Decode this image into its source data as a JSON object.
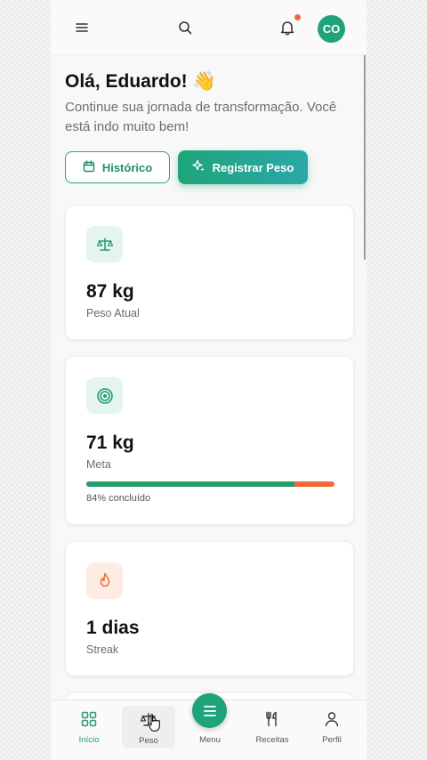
{
  "header": {
    "menu_icon": "menu-icon",
    "search_icon": "search-icon",
    "notifications_icon": "bell-icon",
    "avatar_initials": "CO"
  },
  "greeting": {
    "title": "Olá, Eduardo!",
    "emoji": "👋",
    "subtitle": "Continue sua jornada de transformação. Você está indo muito bem!"
  },
  "actions": {
    "history_label": "Histórico",
    "register_label": "Registrar Peso"
  },
  "cards": [
    {
      "icon": "scale-icon",
      "value": "87 kg",
      "label": "Peso Atual"
    },
    {
      "icon": "target-icon",
      "value": "71 kg",
      "label": "Meta",
      "progress_percent": 84,
      "progress_text": "84% concluído"
    },
    {
      "icon": "flame-icon",
      "value": "1 dias",
      "label": "Streak"
    }
  ],
  "bottom_nav": {
    "items": [
      {
        "label": "Início",
        "icon": "dashboard-icon",
        "active": true
      },
      {
        "label": "Peso",
        "icon": "scale-icon"
      },
      {
        "label": "Menu",
        "icon": "menu-icon"
      },
      {
        "label": "Receitas",
        "icon": "utensils-icon"
      },
      {
        "label": "Perfil",
        "icon": "user-icon"
      }
    ]
  },
  "colors": {
    "primary": "#1fa37a",
    "accent_orange": "#ef6a3a",
    "background": "#f7f8f7"
  }
}
